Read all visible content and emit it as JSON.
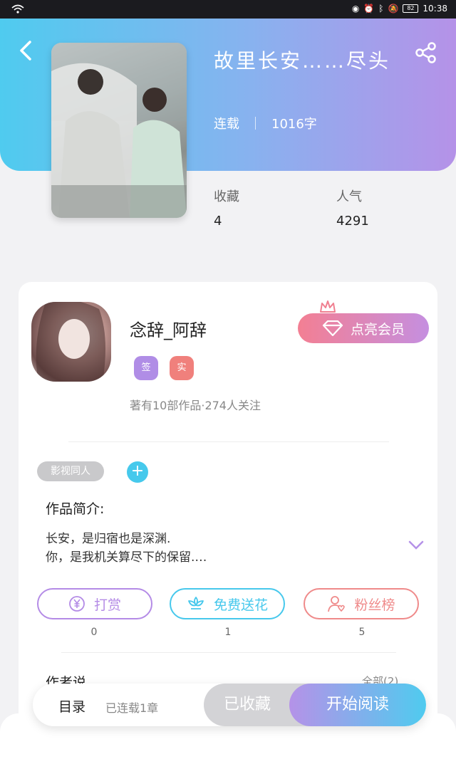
{
  "statusbar": {
    "time": "10:38",
    "battery": "82"
  },
  "book": {
    "title": "故里长安……尽头",
    "status": "连载",
    "word_count": "1016字",
    "stats": [
      {
        "label": "收藏",
        "value": "4"
      },
      {
        "label": "人气",
        "value": "4291"
      }
    ]
  },
  "author": {
    "name": "念辞_阿辞",
    "badges": [
      {
        "label": "签",
        "color": "#b08de6"
      },
      {
        "label": "实",
        "color": "#f0807c"
      }
    ],
    "works_info": "著有10部作品·274人关注",
    "vip_button": "点亮会员"
  },
  "intro": {
    "category_chip": "影视同人",
    "add_label": "+",
    "title": "作品简介:",
    "text": "长安，是归宿也是深渊.\n你，是我机关算尽下的保留.…"
  },
  "actions": [
    {
      "label": "打赏",
      "count": "0",
      "color": "#b48be6",
      "icon": "yen-icon"
    },
    {
      "label": "免费送花",
      "count": "1",
      "color": "#47c8ec",
      "icon": "flower-icon"
    },
    {
      "label": "粉丝榜",
      "count": "5",
      "color": "#ef8a8a",
      "icon": "fans-icon"
    }
  ],
  "author_says": {
    "title": "作者说",
    "all_label": "全部(2)"
  },
  "bottombar": {
    "toc_label": "目录",
    "chapter_status": "已连载1章",
    "favorited_label": "已收藏",
    "read_label": "开始阅读"
  },
  "colors": {
    "header_start": "#4fcbef",
    "header_end": "#b592e8",
    "vip_start": "#f37f93",
    "vip_end": "#c58fe0"
  }
}
